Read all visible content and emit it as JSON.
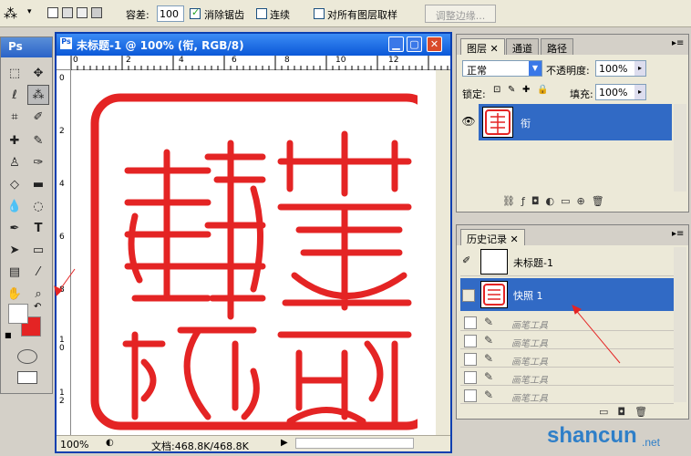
{
  "options": {
    "tolerance_label": "容差:",
    "tolerance_value": "100",
    "antialias_label": "消除锯齿",
    "contiguous_label": "连续",
    "all_layers_label": "对所有图层取样",
    "refine_button": "调整边缘..."
  },
  "toolbox": {
    "title": "Ps"
  },
  "document": {
    "title": "未标题-1 @ 100% (衔, RGB/8)",
    "zoom": "100%",
    "doc_size": "文档:468.8K/468.8K",
    "ruler_top": [
      "0",
      "2",
      "4",
      "6",
      "8",
      "10",
      "12"
    ],
    "ruler_left": [
      "0",
      "2",
      "4",
      "6",
      "8",
      "1 0",
      "1 2"
    ]
  },
  "layers_panel": {
    "tabs": [
      "图层",
      "通道",
      "路径"
    ],
    "blend_mode": "正常",
    "opacity_label": "不透明度:",
    "opacity_value": "100%",
    "lock_label": "锁定:",
    "fill_label": "填充:",
    "fill_value": "100%",
    "layer_name": "衔"
  },
  "history_panel": {
    "tab": "历史记录",
    "snapshot_name": "未标题-1",
    "selected_item": "快照 1",
    "items": [
      "画笔工具",
      "画笔工具",
      "画笔工具",
      "画笔工具",
      "画笔工具"
    ]
  },
  "watermark": {
    "text": "shancun",
    "sub": ".net"
  },
  "colors": {
    "seal_red": "#e42424",
    "selection_blue": "#316ac5",
    "title_blue": "#0b58d8"
  }
}
